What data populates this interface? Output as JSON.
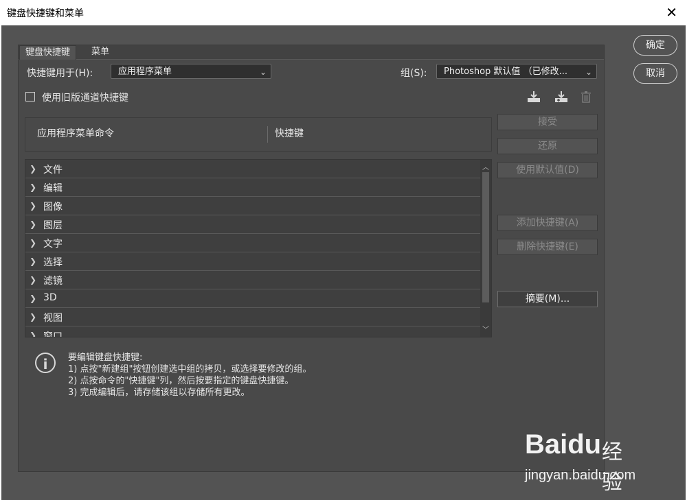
{
  "window": {
    "title": "键盘快捷键和菜单",
    "close_glyph": "✕"
  },
  "tabs": [
    {
      "label": "键盘快捷键",
      "active": true
    },
    {
      "label": "菜单",
      "active": false
    }
  ],
  "shortcuts_for": {
    "label": "快捷键用于(H):",
    "value": "应用程序菜单"
  },
  "group": {
    "label": "组(S):",
    "value": "Photoshop 默认值 （已修改..."
  },
  "legacy_checkbox": {
    "label": "使用旧版通道快捷键",
    "checked": false
  },
  "table": {
    "col_command": "应用程序菜单命令",
    "col_shortcut": "快捷键",
    "rows": [
      "文件",
      "编辑",
      "图像",
      "图层",
      "文字",
      "选择",
      "滤镜",
      "3D",
      "视图",
      "窗口"
    ]
  },
  "side_buttons": {
    "accept": "接受",
    "undo": "还原",
    "use_default": "使用默认值(D)",
    "add_shortcut": "添加快捷键(A)",
    "delete_shortcut": "删除快捷键(E)",
    "summarize": "摘要(M)..."
  },
  "hint": {
    "title": "要编辑键盘快捷键:",
    "line1": "1) 点按\"新建组\"按钮创建选中组的拷贝，或选择要修改的组。",
    "line2": "2) 点按命令的\"快捷键\"列，然后按要指定的键盘快捷键。",
    "line3": "3) 完成编辑后，请存储该组以存储所有更改。"
  },
  "dialog_buttons": {
    "ok": "确定",
    "cancel": "取消"
  },
  "watermark": {
    "logo": "Baidu",
    "cn": "经验",
    "url": "jingyan.baidu.com"
  },
  "icons": [
    "save-set-icon",
    "new-set-icon",
    "delete-set-icon",
    "info-icon",
    "chevron-right-icon",
    "chevron-down-icon"
  ]
}
